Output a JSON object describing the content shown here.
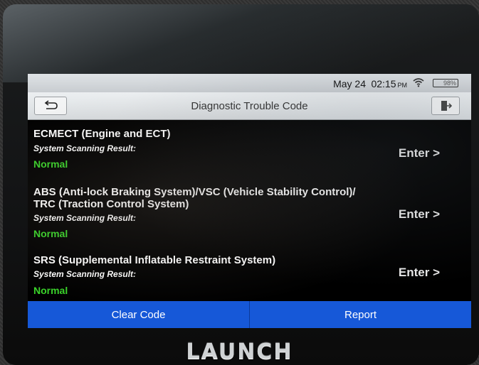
{
  "status_bar": {
    "date": "May 24",
    "time": "02:15",
    "ampm": "PM",
    "battery": "98%"
  },
  "title_bar": {
    "title": "Diagnostic Trouble Code",
    "back_icon": "back-arrow-icon",
    "exit_icon": "exit-door-icon"
  },
  "systems": [
    {
      "name": "ECMECT (Engine and ECT)",
      "result_label": "System Scanning Result:",
      "result": "Normal",
      "enter_label": "Enter >"
    },
    {
      "name": "ABS (Anti-lock Braking System)/VSC (Vehicle Stability Control)/ TRC (Traction Control System)",
      "result_label": "System Scanning Result:",
      "result": "Normal",
      "enter_label": "Enter >"
    },
    {
      "name": "SRS (Supplemental Inflatable Restraint System)",
      "result_label": "System Scanning Result:",
      "result": "Normal",
      "enter_label": "Enter >"
    }
  ],
  "bottom_bar": {
    "clear_code_label": "Clear Code",
    "report_label": "Report"
  },
  "device_brand": "LAUNCH",
  "colors": {
    "normal_status": "#39d429",
    "action_bar": "#1658d8",
    "screen_background": "#000000"
  }
}
